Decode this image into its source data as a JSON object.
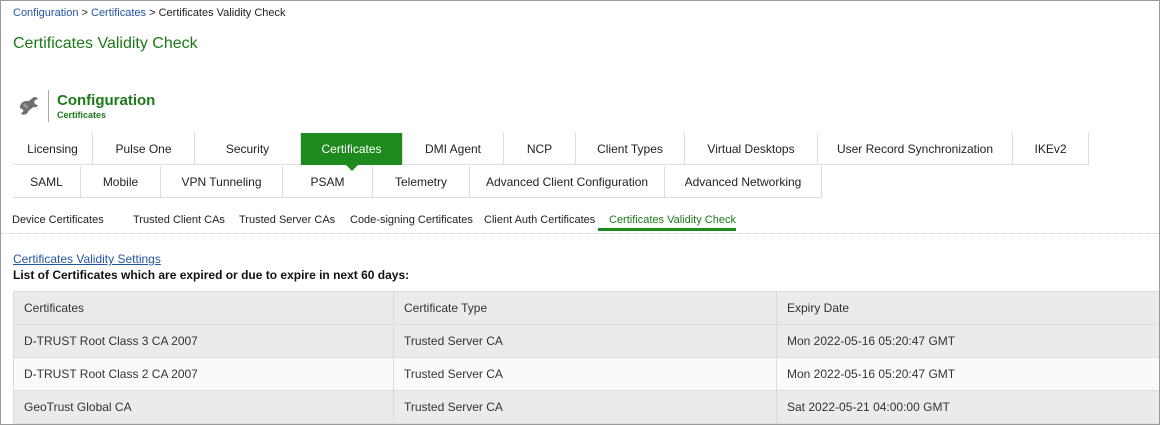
{
  "breadcrumb": {
    "items": [
      "Configuration",
      "Certificates",
      "Certificates Validity Check"
    ],
    "separator": ">"
  },
  "page_title": "Certificates Validity Check",
  "section": {
    "title": "Configuration",
    "subtitle": "Certificates",
    "icon": "wrench-icon"
  },
  "tabs_row1": [
    {
      "label": "Licensing",
      "active": false
    },
    {
      "label": "Pulse One",
      "active": false
    },
    {
      "label": "Security",
      "active": false
    },
    {
      "label": "Certificates",
      "active": true
    },
    {
      "label": "DMI Agent",
      "active": false
    },
    {
      "label": "NCP",
      "active": false
    },
    {
      "label": "Client Types",
      "active": false
    },
    {
      "label": "Virtual Desktops",
      "active": false
    },
    {
      "label": "User Record Synchronization",
      "active": false
    },
    {
      "label": "IKEv2",
      "active": false
    }
  ],
  "tabs_row2": [
    {
      "label": "SAML",
      "active": false
    },
    {
      "label": "Mobile",
      "active": false
    },
    {
      "label": "VPN Tunneling",
      "active": false
    },
    {
      "label": "PSAM",
      "active": false
    },
    {
      "label": "Telemetry",
      "active": false
    },
    {
      "label": "Advanced Client Configuration",
      "active": false
    },
    {
      "label": "Advanced Networking",
      "active": false
    }
  ],
  "subtabs": [
    {
      "label": "Device Certificates",
      "active": false
    },
    {
      "label": "Trusted Client CAs",
      "active": false
    },
    {
      "label": "Trusted Server CAs",
      "active": false
    },
    {
      "label": "Code-signing Certificates",
      "active": false
    },
    {
      "label": "Client Auth Certificates",
      "active": false
    },
    {
      "label": "Certificates Validity Check",
      "active": true
    }
  ],
  "settings_link": "Certificates Validity Settings",
  "list_heading": "List of Certificates which are expired or due to expire in next 60 days:",
  "table": {
    "columns": [
      "Certificates",
      "Certificate Type",
      "Expiry Date"
    ],
    "rows": [
      [
        "D-TRUST Root Class 3 CA 2007",
        "Trusted Server CA",
        "Mon 2022-05-16 05:20:47 GMT"
      ],
      [
        "D-TRUST Root Class 2 CA 2007",
        "Trusted Server CA",
        "Mon 2022-05-16 05:20:47 GMT"
      ],
      [
        "GeoTrust Global CA",
        "Trusted Server CA",
        "Sat 2022-05-21 04:00:00 GMT"
      ]
    ]
  },
  "colors": {
    "accent_green": "#1e8a1e",
    "title_green": "#1c7a18",
    "link_blue": "#2255a4"
  }
}
